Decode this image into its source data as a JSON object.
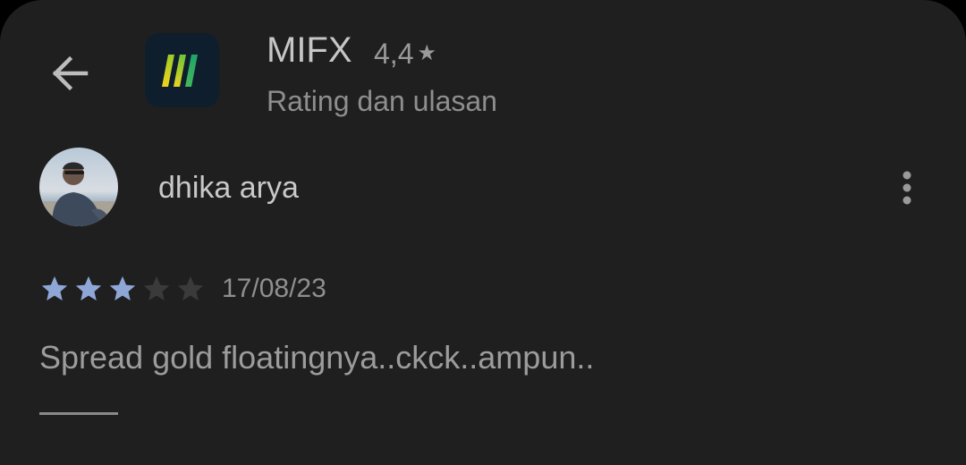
{
  "header": {
    "app_name": "MIFX",
    "rating": "4,4",
    "subtitle": "Rating dan ulasan",
    "icons": {
      "back": "arrow-left-icon",
      "app": "mifx-app-icon",
      "rating_star": "star-icon"
    }
  },
  "review": {
    "reviewer_name": "dhika arya",
    "avatar": "user-avatar-photo",
    "stars_filled": 3,
    "stars_total": 5,
    "date": "17/08/23",
    "text": "Spread gold floatingnya..ckck..ampun..",
    "more_icon": "more-vertical-icon"
  },
  "colors": {
    "background": "#1f1f1f",
    "star_filled": "#8fa7d6",
    "star_empty": "#3a3a3a",
    "app_icon_bg": "#0f1e2c"
  }
}
